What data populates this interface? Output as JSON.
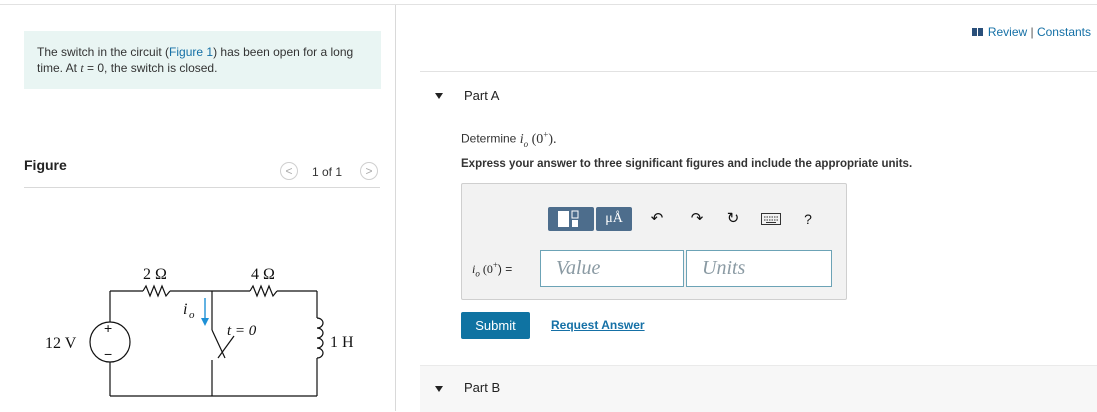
{
  "problem": {
    "text_before": "The switch in the circuit (",
    "figure_link": "Figure 1",
    "text_after_link": ") has been open for a long time. At ",
    "time_var": "t",
    "time_eq": " = 0, the switch is closed."
  },
  "figure": {
    "title": "Figure",
    "pager": "1 of 1",
    "prev": "<",
    "next": ">",
    "circuit": {
      "r1": "2 Ω",
      "r2": "4 Ω",
      "source": "12 V",
      "plus": "+",
      "minus": "−",
      "current": "i",
      "current_sub": "o",
      "switch": "t = 0",
      "inductor": "1 H"
    }
  },
  "header": {
    "review": "Review",
    "separator": " | ",
    "constants": "Constants"
  },
  "partA": {
    "label": "Part A",
    "determine": "Determine ",
    "expr_var": "i",
    "expr_sub": "o",
    "expr_arg": "(0",
    "expr_sup": "+",
    "expr_close": ").",
    "instruction": "Express your answer to three significant figures and include the appropriate units.",
    "toolbar": {
      "units_btn": "μÅ",
      "help": "?"
    },
    "answer_label": "i",
    "answer_sub": "o",
    "answer_arg": " (0",
    "answer_sup": "+",
    "answer_eq": ") =",
    "value_placeholder": "Value",
    "units_placeholder": "Units",
    "submit": "Submit",
    "request": "Request Answer"
  },
  "partB": {
    "label": "Part B"
  }
}
